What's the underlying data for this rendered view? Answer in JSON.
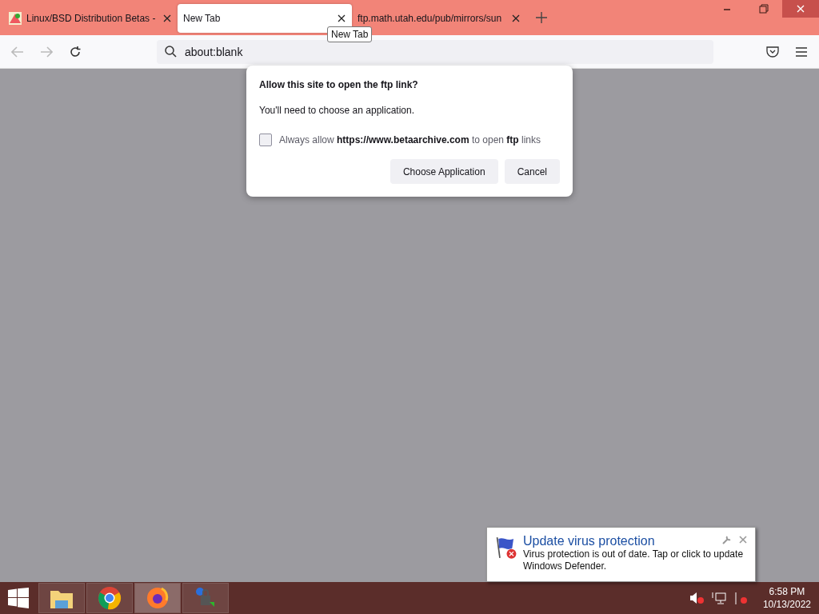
{
  "tabs": [
    {
      "title": "Linux/BSD Distribution Betas -",
      "selected": false,
      "favicon": true
    },
    {
      "title": "New Tab",
      "selected": true,
      "favicon": false
    },
    {
      "title": "ftp.math.utah.edu/pub/mirrors/sun",
      "selected": false,
      "favicon": false
    }
  ],
  "tooltip": "New Tab",
  "address_bar": {
    "value": "about:blank"
  },
  "dialog": {
    "title": "Allow this site to open the ftp link?",
    "message": "You'll need to choose an application.",
    "checkbox": {
      "label": "Always allow **https://www.betaarchive.com** to open **ftp** links",
      "checked": false
    },
    "buttons": [
      "Choose Application",
      "Cancel"
    ]
  },
  "notification": {
    "title": "Update virus protection",
    "message": "Virus protection is out of date. Tap or click to update Windows Defender."
  },
  "taskbar": {
    "apps": [
      {
        "kind": "folder",
        "selected": false
      },
      {
        "kind": "chrome",
        "selected": false
      },
      {
        "kind": "firefox",
        "selected": true
      },
      {
        "kind": "network",
        "selected": false
      }
    ],
    "time": "6:58 PM",
    "date": "10/13/2022"
  }
}
